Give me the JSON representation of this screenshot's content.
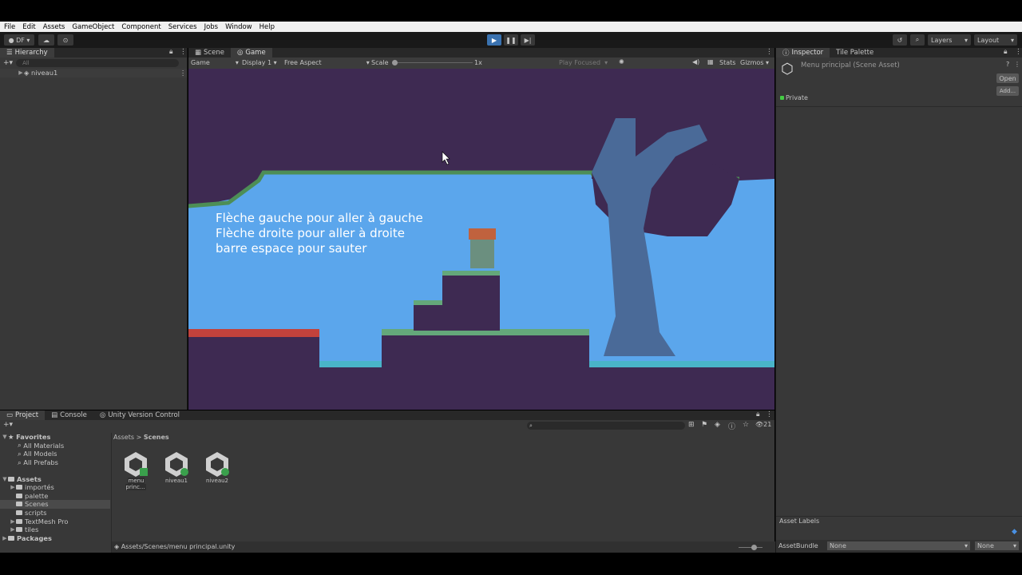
{
  "menubar": {
    "items": [
      "File",
      "Edit",
      "Assets",
      "GameObject",
      "Component",
      "Services",
      "Jobs",
      "Window",
      "Help"
    ]
  },
  "toolbar": {
    "account": "DF",
    "layers": "Layers",
    "layout": "Layout"
  },
  "hierarchy": {
    "tab": "Hierarchy",
    "search_placeholder": "All",
    "scene": "niveau1"
  },
  "view": {
    "tabs": [
      "Scene",
      "Game"
    ],
    "display_mode": "Game",
    "display": "Display 1",
    "aspect": "Free Aspect",
    "scale_label": "Scale",
    "scale_value": "1x",
    "play_focused": "Play Focused",
    "stats": "Stats",
    "gizmos": "Gizmos"
  },
  "game_text": [
    "Flèche gauche pour aller à gauche",
    "Flèche droite pour aller à droite",
    "barre espace pour sauter"
  ],
  "inspector": {
    "tabs": [
      "Inspector",
      "Tile Palette"
    ],
    "title": "Menu principal (Scene Asset)",
    "open": "Open",
    "private": "Private",
    "add": "Add...",
    "asset_labels": "Asset Labels",
    "assetbundle_label": "AssetBundle",
    "assetbundle_value": "None",
    "variant_value": "None"
  },
  "project": {
    "tabs": [
      "Project",
      "Console",
      "Unity Version Control"
    ],
    "count": "21",
    "favorites": {
      "label": "Favorites",
      "items": [
        "All Materials",
        "All Models",
        "All Prefabs"
      ]
    },
    "assets": {
      "label": "Assets",
      "items": [
        "importés",
        "palette",
        "Scenes",
        "scripts",
        "TextMesh Pro",
        "tiles"
      ]
    },
    "packages": "Packages",
    "breadcrumb": [
      "Assets",
      "Scenes"
    ],
    "files": [
      "menu princ...",
      "niveau1",
      "niveau2"
    ],
    "path": "Assets/Scenes/menu principal.unity"
  },
  "colors": {
    "sky": "#5ba6ec",
    "dark": "#3e2a52",
    "accent": "#3a72b0"
  }
}
